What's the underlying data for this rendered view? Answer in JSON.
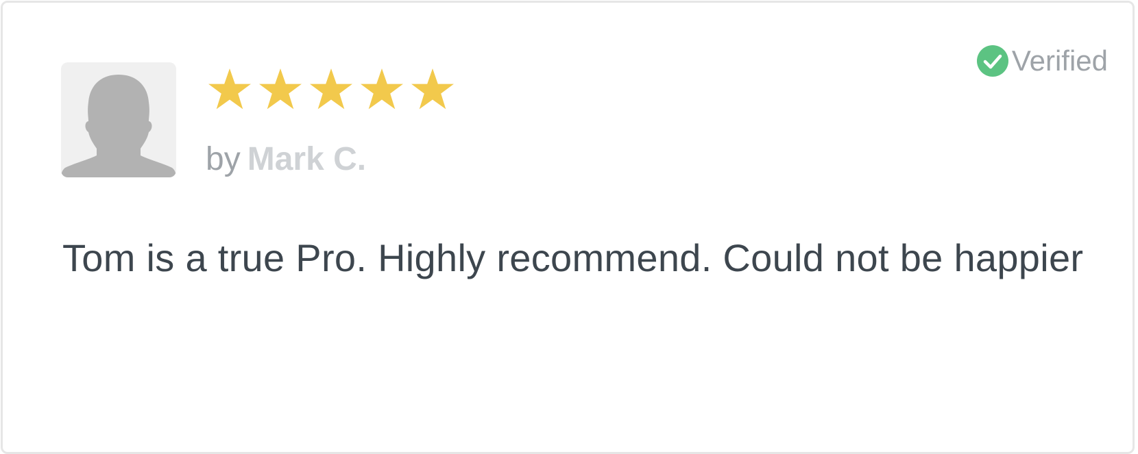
{
  "review": {
    "rating": 5,
    "rating_max": 5,
    "star_color": "#f2c94c",
    "by_label": "by",
    "author": "Mark C.",
    "verified_label": "Verified",
    "verified_color": "#5cc382",
    "text": "Tom is a true Pro. Highly recommend. Could not be happier",
    "avatar_icon": "default-user-silhouette-icon",
    "verified_icon": "check-circle-icon",
    "star_icon": "star-icon"
  }
}
